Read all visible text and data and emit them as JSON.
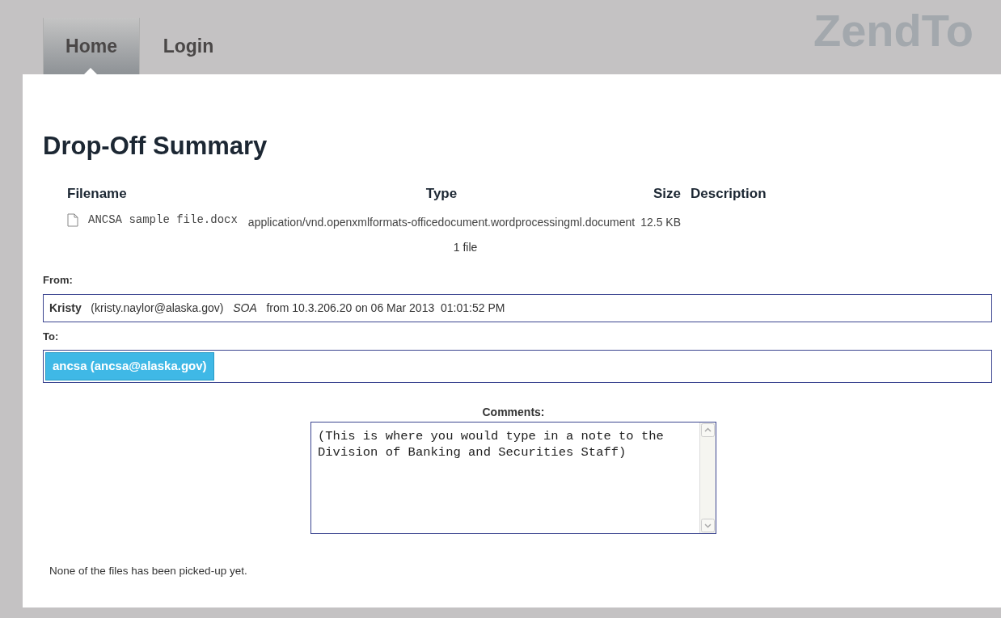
{
  "nav": {
    "tabs": [
      {
        "label": "Home",
        "selected": true
      },
      {
        "label": "Login",
        "selected": false
      }
    ],
    "logo": "ZendTo"
  },
  "title": "Drop-Off Summary",
  "files": {
    "columns": [
      "Filename",
      "Type",
      "Size",
      "Description"
    ],
    "rows": [
      {
        "filename": "ANCSA sample file.docx",
        "type": "application/vnd.openxmlformats-officedocument.wordprocessingml.document",
        "size": "12.5 KB"
      }
    ],
    "count": "1 file"
  },
  "from": {
    "label": "From:",
    "name": "Kristy",
    "email": "(kristy.naylor@alaska.gov)",
    "organization": "SOA",
    "origin": "from 10.3.206.20 on 06 Mar 2013  01:01:52 PM"
  },
  "to": {
    "label": "To:",
    "recipients": [
      "ancsa (ancsa@alaska.gov)"
    ]
  },
  "comments": {
    "label": "Comments:",
    "value": "(This is where you would type in a note to the Division of Banking and Securities Staff)"
  },
  "pickup_status": "None of the files has been picked-up yet."
}
